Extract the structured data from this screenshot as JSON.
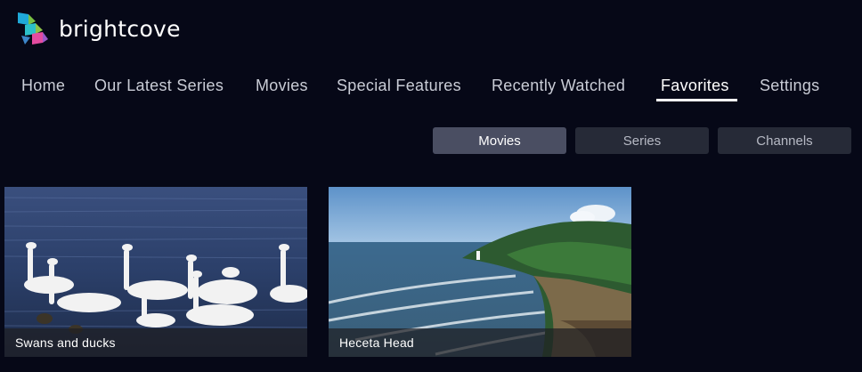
{
  "brand": {
    "name": "brightcove"
  },
  "nav": {
    "items": [
      {
        "label": "Home"
      },
      {
        "label": "Our Latest Series"
      },
      {
        "label": "Movies"
      },
      {
        "label": "Special Features"
      },
      {
        "label": "Recently Watched"
      },
      {
        "label": "Favorites",
        "active": true
      },
      {
        "label": "Settings"
      }
    ]
  },
  "subtabs": [
    {
      "label": "Movies",
      "active": true
    },
    {
      "label": "Series"
    },
    {
      "label": "Channels"
    }
  ],
  "cards": [
    {
      "title": "Swans and ducks"
    },
    {
      "title": "Heceta Head"
    }
  ],
  "colors": {
    "background": "#060817",
    "active_tab": "#4a4e62",
    "inactive_tab": "#262a37"
  }
}
